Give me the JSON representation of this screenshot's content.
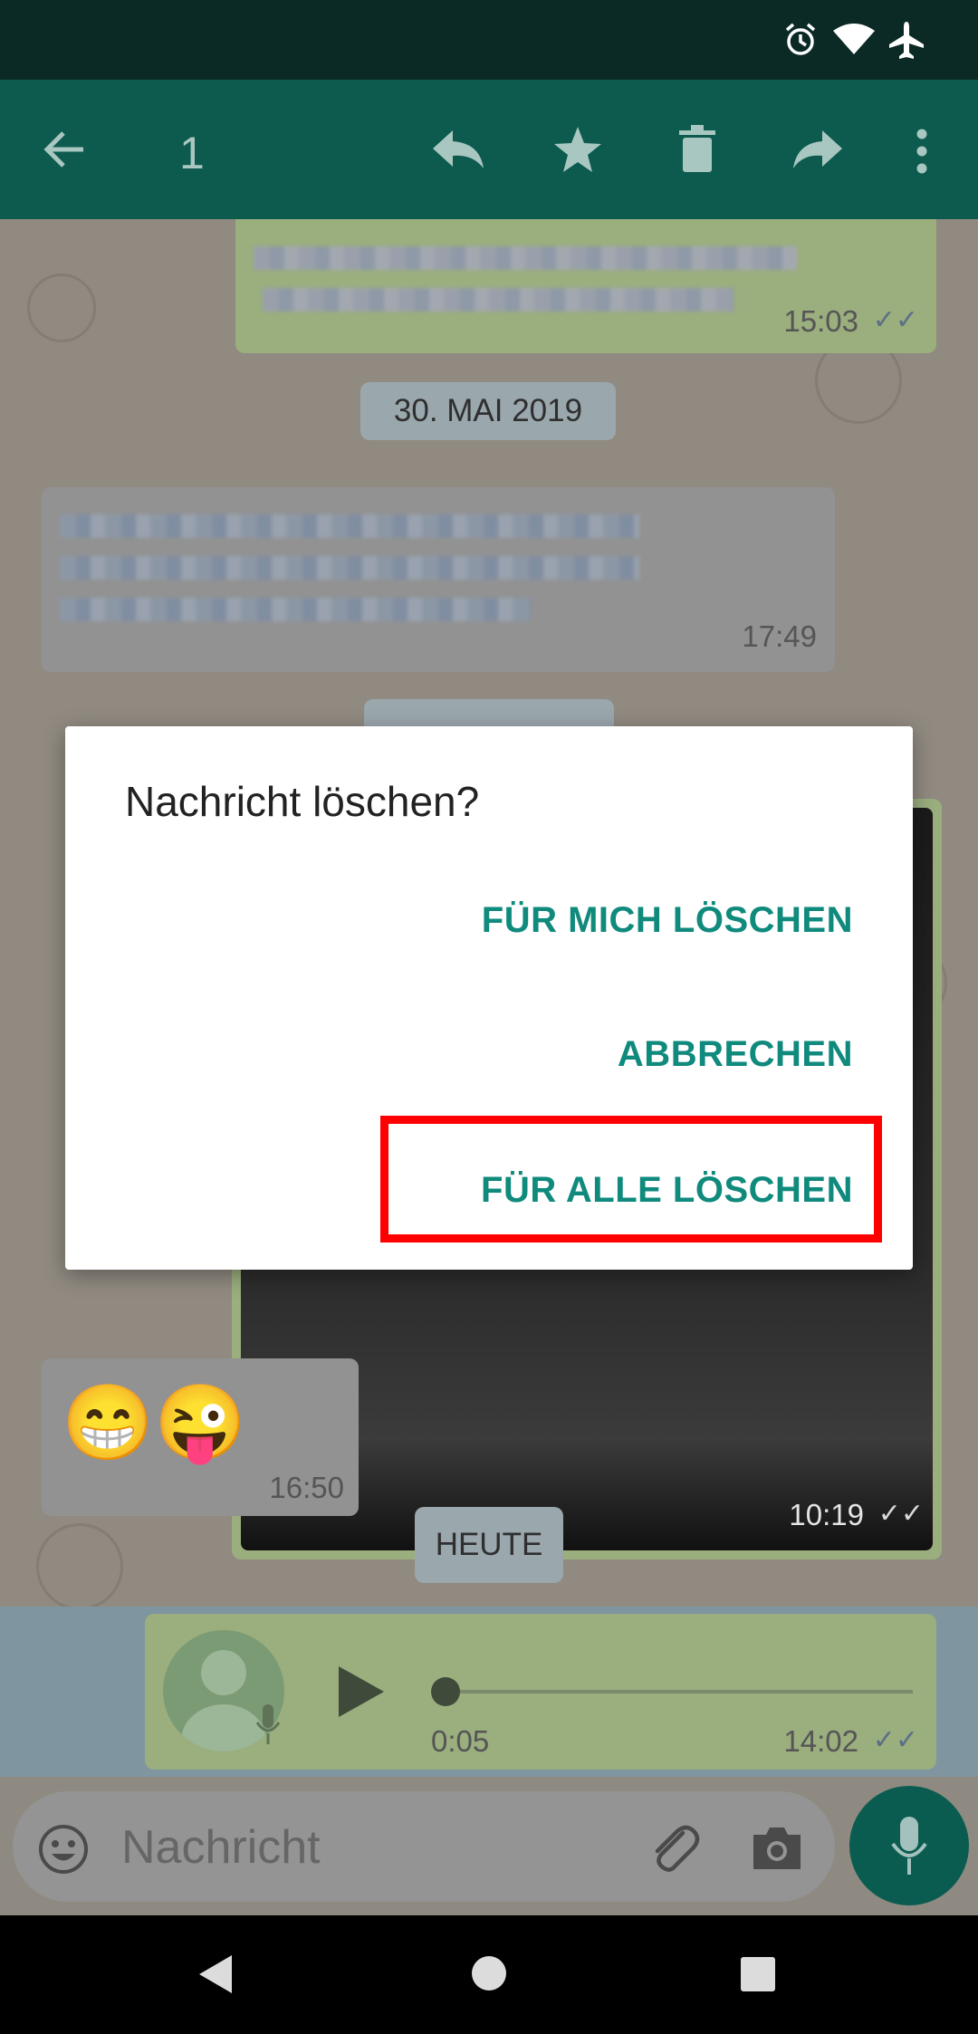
{
  "action_bar": {
    "selected_count": "1",
    "icons": [
      "back-arrow-icon",
      "reply-icon",
      "star-icon",
      "delete-icon",
      "forward-icon",
      "more-vert-icon"
    ]
  },
  "status_bar": {
    "icons": [
      "alarm-icon",
      "wifi-icon",
      "airplane-icon"
    ]
  },
  "chat": {
    "messages": [
      {
        "direction": "out",
        "time": "15:03",
        "read": true
      },
      {
        "date_chip": "30. MAI 2019"
      },
      {
        "direction": "in",
        "time": "17:49"
      },
      {
        "direction": "out",
        "type": "image",
        "time": "10:19",
        "read": true
      },
      {
        "direction": "in",
        "emojis": "😁😜",
        "time": "16:50"
      },
      {
        "date_chip": "HEUTE"
      },
      {
        "direction": "out",
        "type": "voice",
        "duration": "0:05",
        "time": "14:02",
        "read": true
      }
    ]
  },
  "input": {
    "placeholder": "Nachricht"
  },
  "dialog": {
    "title": "Nachricht löschen?",
    "delete_for_me": "FÜR MICH LÖSCHEN",
    "cancel": "ABBRECHEN",
    "delete_for_all": "FÜR ALLE LÖSCHEN"
  },
  "colors": {
    "header": "#0d5a4f",
    "accent": "#0f8a7c",
    "highlight": "#ff0000"
  }
}
